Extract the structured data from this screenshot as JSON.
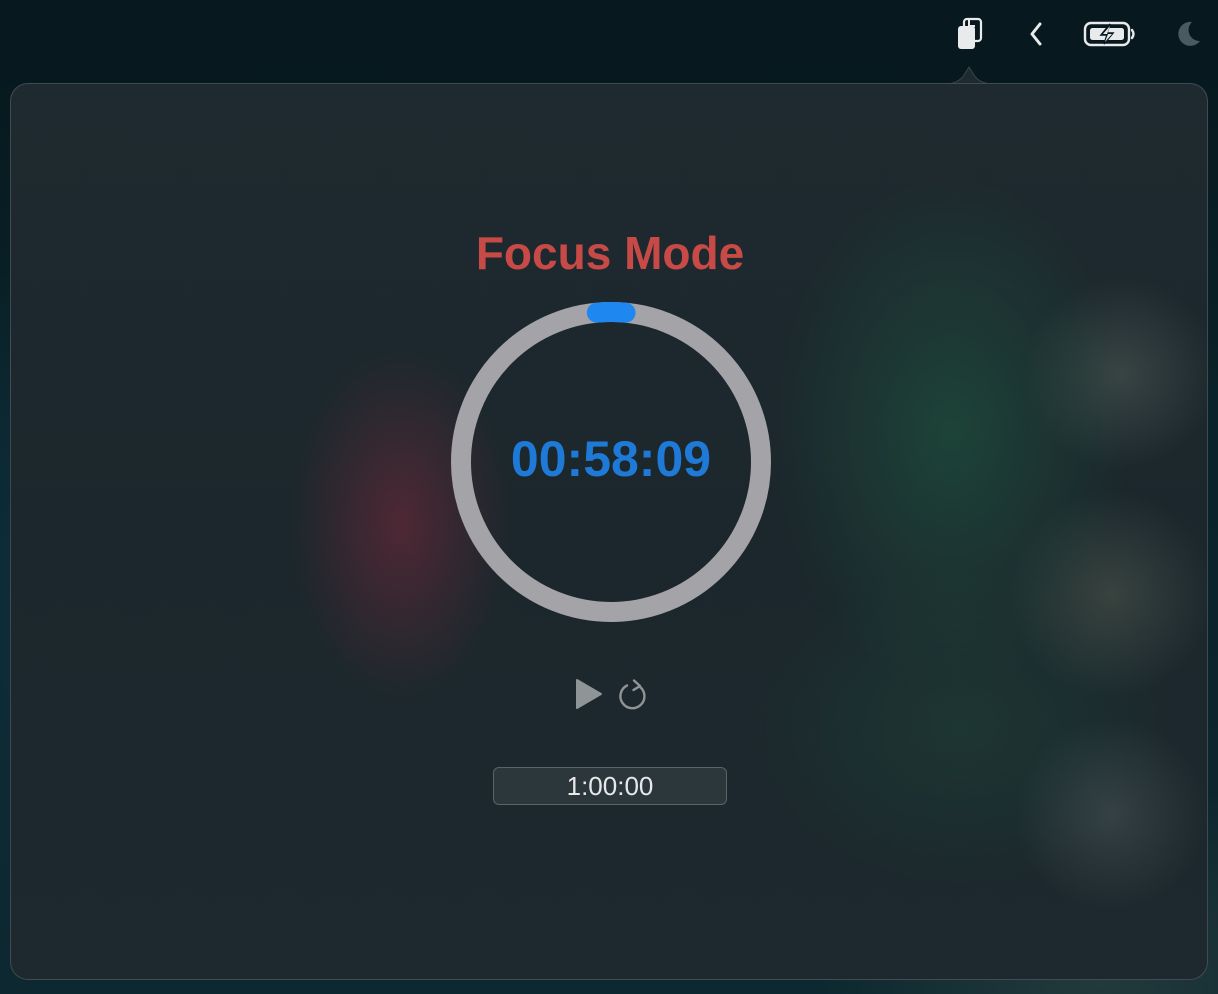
{
  "menubar": {
    "icons": [
      "clipboard-icon",
      "chevron-left-icon",
      "battery-charging-icon",
      "moon-icon"
    ]
  },
  "timer": {
    "title": "Focus Mode",
    "remaining": "00:58:09",
    "duration": "1:00:00",
    "progress_fraction": 0.031,
    "colors": {
      "title": "#c84a46",
      "remaining": "#1e7ad6",
      "progress": "#1e88f0",
      "ring_track": "#a4a3a8"
    }
  },
  "controls": {
    "icons": [
      "play-icon",
      "reset-icon"
    ]
  }
}
